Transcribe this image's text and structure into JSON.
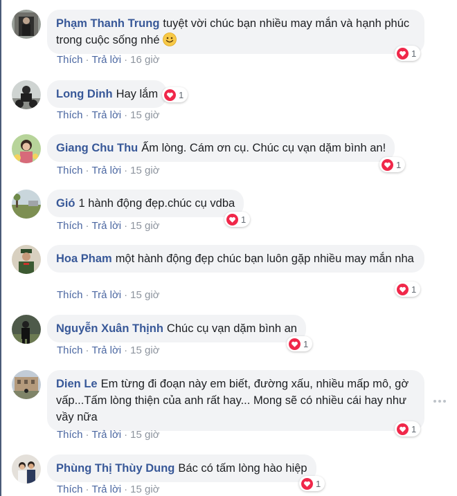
{
  "colors": {
    "author": "#385898",
    "link": "#4b67a1",
    "muted": "#8d949e",
    "bubble": "#f2f3f5",
    "heart": "#f0284a"
  },
  "comments": [
    {
      "author": "Phạm Thanh Trung",
      "text": "tuyệt vời chúc bạn nhiều may mắn và hạnh phúc trong cuộc sống nhé",
      "emoji": "smile-emoji-icon",
      "like": "Thích",
      "reply": "Trả lời",
      "time": "16 giờ",
      "reactions": "1"
    },
    {
      "author": "Long Dinh",
      "text": "Hay lắm",
      "like": "Thích",
      "reply": "Trả lời",
      "time": "15 giờ",
      "reactions": "1"
    },
    {
      "author": "Giang Chu Thu",
      "text": "Ấm lòng. Cám ơn cụ. Chúc cụ vạn dặm bình an!",
      "like": "Thích",
      "reply": "Trả lời",
      "time": "15 giờ",
      "reactions": "1"
    },
    {
      "author": "Gió",
      "text": "1 hành động đẹp.chúc cụ vdba",
      "like": "Thích",
      "reply": "Trả lời",
      "time": "15 giờ",
      "reactions": "1"
    },
    {
      "author": "Hoa Pham",
      "text": "một hành động đẹp chúc bạn luôn gặp nhiều may mắn nha",
      "like": "Thích",
      "reply": "Trả lời",
      "time": "15 giờ",
      "reactions": "1"
    },
    {
      "author": "Nguyễn Xuân Thịnh",
      "text": "Chúc cụ vạn dặm bình an",
      "like": "Thích",
      "reply": "Trả lời",
      "time": "15 giờ",
      "reactions": "1"
    },
    {
      "author": "Dien Le",
      "text": "Em từng đi đoạn này em biết, đường xấu, nhiều mấp mô, gờ vấp...Tấm lòng thiện của anh rất hay... Mong sẽ có nhiều cái hay như vầy nữa",
      "like": "Thích",
      "reply": "Trả lời",
      "time": "15 giờ",
      "reactions": "1"
    },
    {
      "author": "Phùng Thị Thùy Dung",
      "text": "Bác có tấm lòng hào hiệp",
      "like": "Thích",
      "reply": "Trả lời",
      "time": "15 giờ",
      "reactions": "1"
    }
  ]
}
